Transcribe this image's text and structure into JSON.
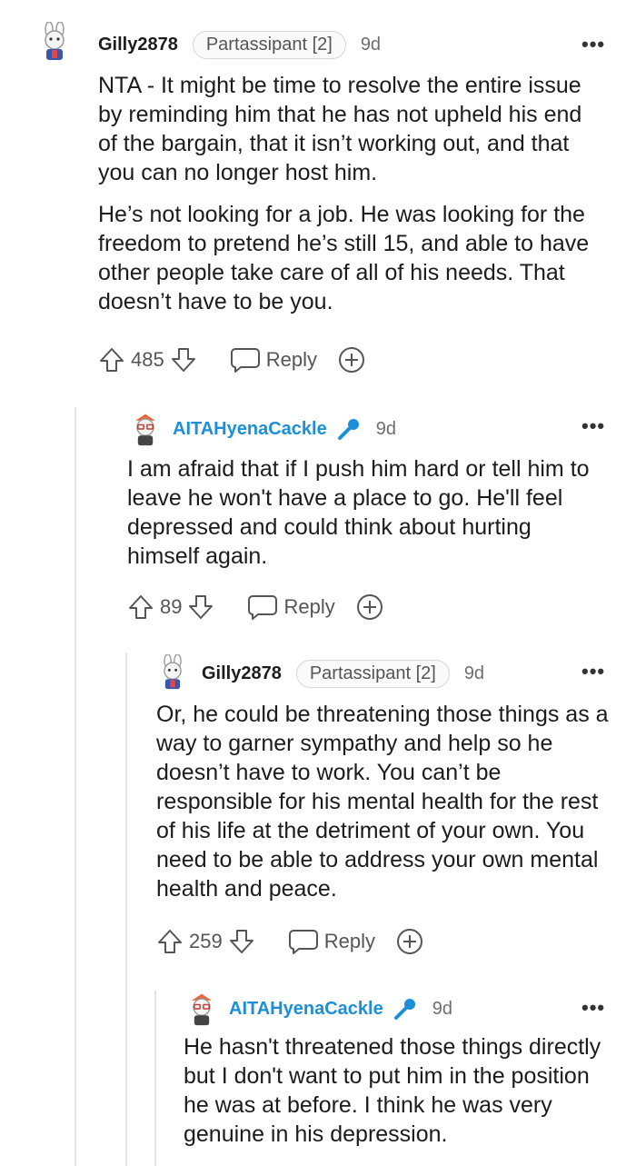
{
  "comments": [
    {
      "username": "Gilly2878",
      "flair": "Partassipant [2]",
      "age": "9d",
      "paragraphs": [
        "NTA - It might be time to resolve the entire issue by reminding him that he has not upheld his end of the bargain, that it isn’t working out, and that you can no longer host him.",
        "He’s not looking for a job. He was looking for the freedom to pretend he’s still 15, and able to have other people take care of all of his needs. That doesn’t have to be you."
      ],
      "votes": "485",
      "reply_label": "Reply"
    },
    {
      "username": "AITAHyenaCackle",
      "age": "9d",
      "paragraphs": [
        "I am afraid that if I push him hard or tell him to leave he won't have a place to go. He'll feel depressed and could think about hurting himself again."
      ],
      "votes": "89",
      "reply_label": "Reply"
    },
    {
      "username": "Gilly2878",
      "flair": "Partassipant [2]",
      "age": "9d",
      "paragraphs": [
        "Or, he could be threatening those things as a way to garner sympathy and help so he doesn’t have to work. You can’t be responsible for his mental health for the rest of his life at the detriment of your own. You need to be able to address your own mental health and peace."
      ],
      "votes": "259",
      "reply_label": "Reply"
    },
    {
      "username": "AITAHyenaCackle",
      "age": "9d",
      "paragraphs": [
        "He hasn't threatened those things directly but I don't want to put him in the position he was at before. I think he was very genuine in his depression."
      ]
    }
  ],
  "more_label": "•••",
  "colors": {
    "op_username": "#1d8fd9",
    "thread_line": "#e5e5e5",
    "mic": "#1d8fd9"
  },
  "icons": [
    "avatar-icon",
    "upvote-icon",
    "downvote-icon",
    "reply-icon",
    "award-icon",
    "microphone-icon",
    "more-options-icon"
  ]
}
